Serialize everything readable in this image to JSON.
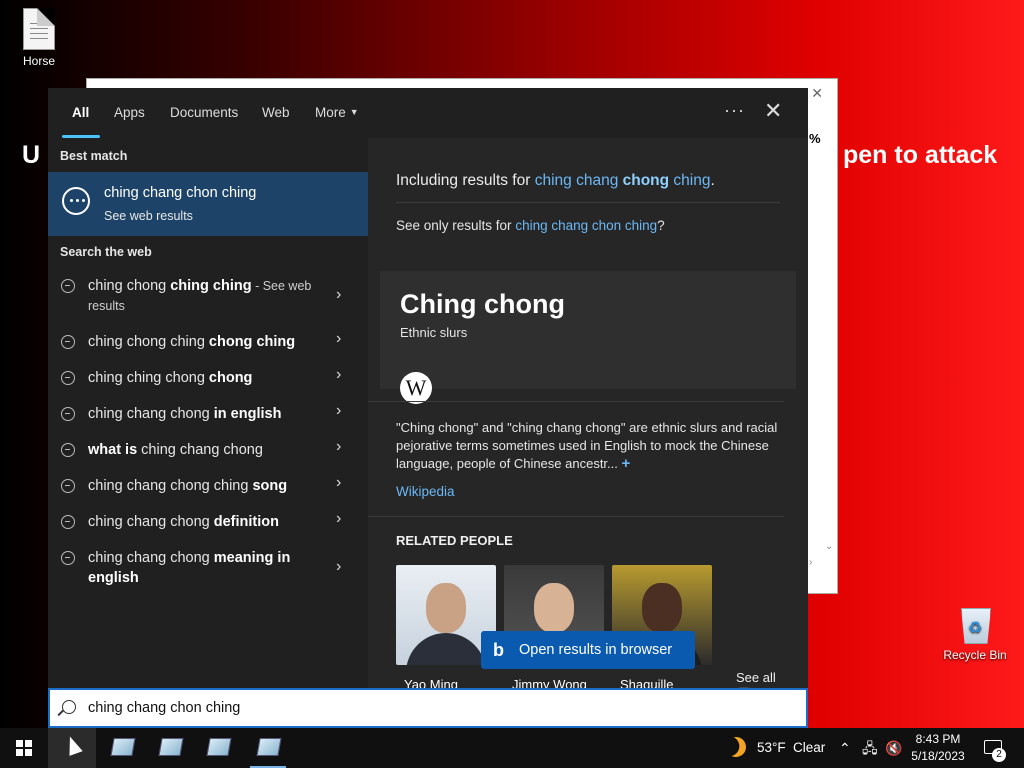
{
  "desktop": {
    "horse_label": "Horse",
    "recycle_label": "Recycle Bin",
    "banner_left": "U",
    "banner_right": "pen to attack",
    "bg_window_pct": "%"
  },
  "tabs": [
    {
      "label": "All"
    },
    {
      "label": "Apps"
    },
    {
      "label": "Documents"
    },
    {
      "label": "Web"
    },
    {
      "label": "More"
    }
  ],
  "left": {
    "best_match_heading": "Best match",
    "best_match_title": "ching chang chon ching",
    "best_match_sub": "See web results",
    "search_web_heading": "Search the web",
    "suggestions": [
      {
        "normal": "ching chong ",
        "bold": "ching ching",
        "suffix": " - See web results"
      },
      {
        "normal": "ching chong ching ",
        "bold": "chong ching",
        "suffix": ""
      },
      {
        "normal": "ching ching chong ",
        "bold": "chong",
        "suffix": ""
      },
      {
        "normal": "ching chang chong ",
        "bold": "in english",
        "suffix": ""
      },
      {
        "normal": " ching chang chong",
        "bold": "what is",
        "suffix": ""
      },
      {
        "normal": "ching chang chong ching ",
        "bold": "song",
        "suffix": ""
      },
      {
        "normal": "ching chang chong ",
        "bold": "definition",
        "suffix": ""
      },
      {
        "normal": "ching chang chong ",
        "bold": "meaning in english",
        "suffix": ""
      }
    ]
  },
  "right": {
    "including_prefix": "Including results for ",
    "including_a": "ching chang ",
    "including_b": "chong",
    "including_c": " ching",
    "including_end": ".",
    "only_prefix": "See only results for ",
    "only_link": "ching chang chon ching",
    "only_end": "?",
    "card_title": "Ching chong",
    "card_sub": "Ethnic slurs",
    "wiki_glyph": "W",
    "description": "\"Ching chong\" and \"ching chang chong\" are ethnic slurs and racial pejorative terms sometimes used in English to mock the Chinese language, people of Chinese ancestr...",
    "desc_plus": "+",
    "wiki_link": "Wikipedia",
    "related_heading": "RELATED PEOPLE",
    "people": [
      {
        "name": "Yao Ming"
      },
      {
        "name": "Jimmy Wong"
      },
      {
        "name": "Shaquille"
      }
    ],
    "see_all": "See all",
    "open_browser": "Open results in browser"
  },
  "search": {
    "value": "ching chang chon ching"
  },
  "taskbar": {
    "temperature": "53°F",
    "weather": "Clear",
    "time": "8:43 PM",
    "date": "5/18/2023",
    "notifications": "2"
  }
}
